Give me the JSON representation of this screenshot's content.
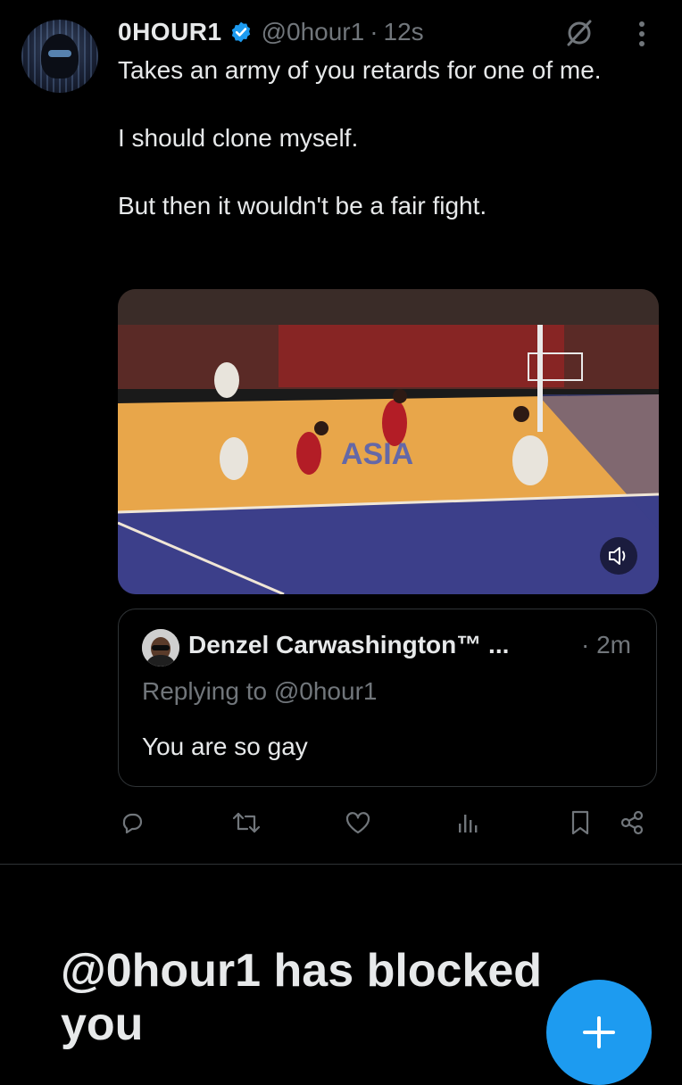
{
  "tweet": {
    "author_name": "0HOUR1",
    "handle": "@0hour1",
    "separator": "·",
    "timestamp": "12s",
    "text_lines": [
      "Takes an army of you retards for one of me.",
      "I should clone myself.",
      "But then it wouldn't be a fair fight."
    ],
    "media_overlay_text": "ASIA"
  },
  "quoted_tweet": {
    "author_name": "Denzel Carwashington™ ...",
    "time": "· 2m",
    "replying_to": "Replying to @0hour1",
    "text": "You are so gay"
  },
  "actions": [
    "reply-icon",
    "retweet-icon",
    "like-icon",
    "views-icon",
    "bookmark-icon",
    "share-icon"
  ],
  "blocked_message": "@0hour1 has blocked you",
  "colors": {
    "background": "#000000",
    "primary_text": "#e7e9ea",
    "secondary_text": "#71767b",
    "border": "#2f3336",
    "accent": "#1d9bf0"
  }
}
